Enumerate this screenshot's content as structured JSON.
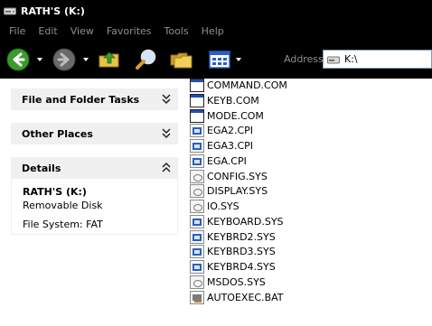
{
  "window": {
    "title": "RATH'S (K:)"
  },
  "menu": [
    "File",
    "Edit",
    "View",
    "Favorites",
    "Tools",
    "Help"
  ],
  "toolbar": {
    "address_label": "Address",
    "address_value": "K:\\"
  },
  "taskpane": {
    "file_folder_tasks": "File and Folder Tasks",
    "other_places": "Other Places",
    "details": {
      "header": "Details",
      "name": "RATH'S (K:)",
      "type": "Removable Disk",
      "filesystem": "File System: FAT"
    }
  },
  "files": [
    {
      "name": "COMMAND.COM",
      "icon": "com-program-icon"
    },
    {
      "name": "KEYB.COM",
      "icon": "com-program-icon"
    },
    {
      "name": "MODE.COM",
      "icon": "com-program-icon"
    },
    {
      "name": "EGA2.CPI",
      "icon": "cpi-file-icon"
    },
    {
      "name": "EGA3.CPI",
      "icon": "cpi-file-icon"
    },
    {
      "name": "EGA.CPI",
      "icon": "cpi-file-icon"
    },
    {
      "name": "CONFIG.SYS",
      "icon": "sys-file-icon"
    },
    {
      "name": "DISPLAY.SYS",
      "icon": "sys-file-icon"
    },
    {
      "name": "IO.SYS",
      "icon": "sys-file-icon"
    },
    {
      "name": "KEYBOARD.SYS",
      "icon": "cpi-file-icon"
    },
    {
      "name": "KEYBRD2.SYS",
      "icon": "cpi-file-icon"
    },
    {
      "name": "KEYBRD3.SYS",
      "icon": "cpi-file-icon"
    },
    {
      "name": "KEYBRD4.SYS",
      "icon": "cpi-file-icon"
    },
    {
      "name": "MSDOS.SYS",
      "icon": "sys-file-icon"
    },
    {
      "name": "AUTOEXEC.BAT",
      "icon": "bat-file-icon"
    }
  ],
  "colors": {
    "bar_background": "#000000",
    "menu_text": "#8f8f8f",
    "pane_header": "#f0f0f0"
  }
}
